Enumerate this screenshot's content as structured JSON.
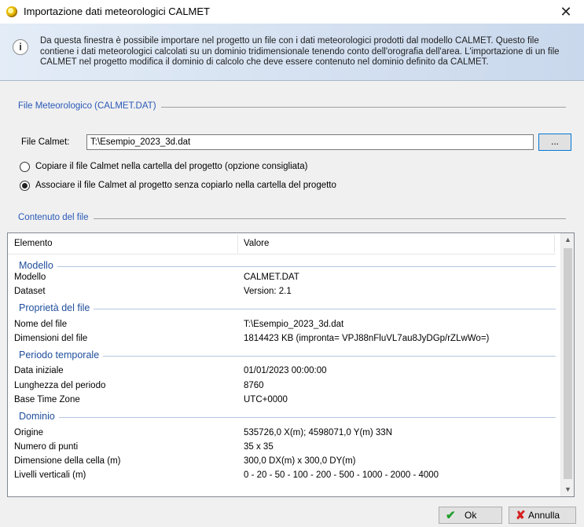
{
  "window": {
    "title": "Importazione dati meteorologici CALMET",
    "close_glyph": "✕"
  },
  "info": {
    "icon": "info-icon",
    "text": "Da questa finestra è possibile importare nel progetto un file con i dati meteorologici prodotti dal modello CALMET. Questo file contiene i dati meteorologici calcolati su un dominio tridimensionale tenendo conto dell'orografia dell'area. L'importazione di un file CALMET nel progetto modifica il dominio di calcolo che deve essere contenuto nel dominio definito da CALMET."
  },
  "file_section": {
    "title": "File Meteorologico (CALMET.DAT)",
    "file_label": "File Calmet:",
    "file_value": "T:\\Esempio_2023_3d.dat",
    "browse_label": "...",
    "option_copy": "Copiare il file Calmet nella cartella del progetto (opzione consigliata)",
    "option_link": "Associare il file Calmet al progetto senza copiarlo nella cartella del progetto",
    "selected_option": "link"
  },
  "content_section": {
    "title": "Contenuto del file",
    "columns": [
      "Elemento",
      "Valore"
    ],
    "groups": [
      {
        "name": "Modello",
        "rows": [
          {
            "key": "Modello",
            "value": "CALMET.DAT"
          },
          {
            "key": "Dataset",
            "value": "Version: 2.1"
          }
        ]
      },
      {
        "name": "Proprietà del file",
        "rows": [
          {
            "key": "Nome del file",
            "value": "T:\\Esempio_2023_3d.dat"
          },
          {
            "key": "Dimensioni del file",
            "value": "1814423 KB (impronta= VPJ88nFluVL7au8JyDGp/rZLwWo=)"
          }
        ]
      },
      {
        "name": "Periodo temporale",
        "rows": [
          {
            "key": "Data iniziale",
            "value": "01/01/2023 00:00:00"
          },
          {
            "key": "Lunghezza del periodo",
            "value": "8760"
          },
          {
            "key": "Base Time Zone",
            "value": "UTC+0000"
          }
        ]
      },
      {
        "name": "Dominio",
        "rows": [
          {
            "key": "Origine",
            "value": "535726,0 X(m); 4598071,0 Y(m) 33N"
          },
          {
            "key": "Numero di punti",
            "value": "35 x 35"
          },
          {
            "key": "Dimensione della cella (m)",
            "value": "300,0 DX(m) x 300,0 DY(m)"
          },
          {
            "key": "Livelli verticali (m)",
            "value": "0 - 20 - 50 - 100 - 200 - 500 - 1000 - 2000 - 4000"
          }
        ]
      }
    ]
  },
  "buttons": {
    "ok": "Ok",
    "cancel": "Annulla"
  },
  "scrollbar": {
    "up_glyph": "▲",
    "down_glyph": "▼"
  },
  "colors": {
    "section_title": "#2a59b8",
    "group_title": "#1f4e9c",
    "ok_icon": "#1e9e2a",
    "cancel_icon": "#d62020"
  }
}
